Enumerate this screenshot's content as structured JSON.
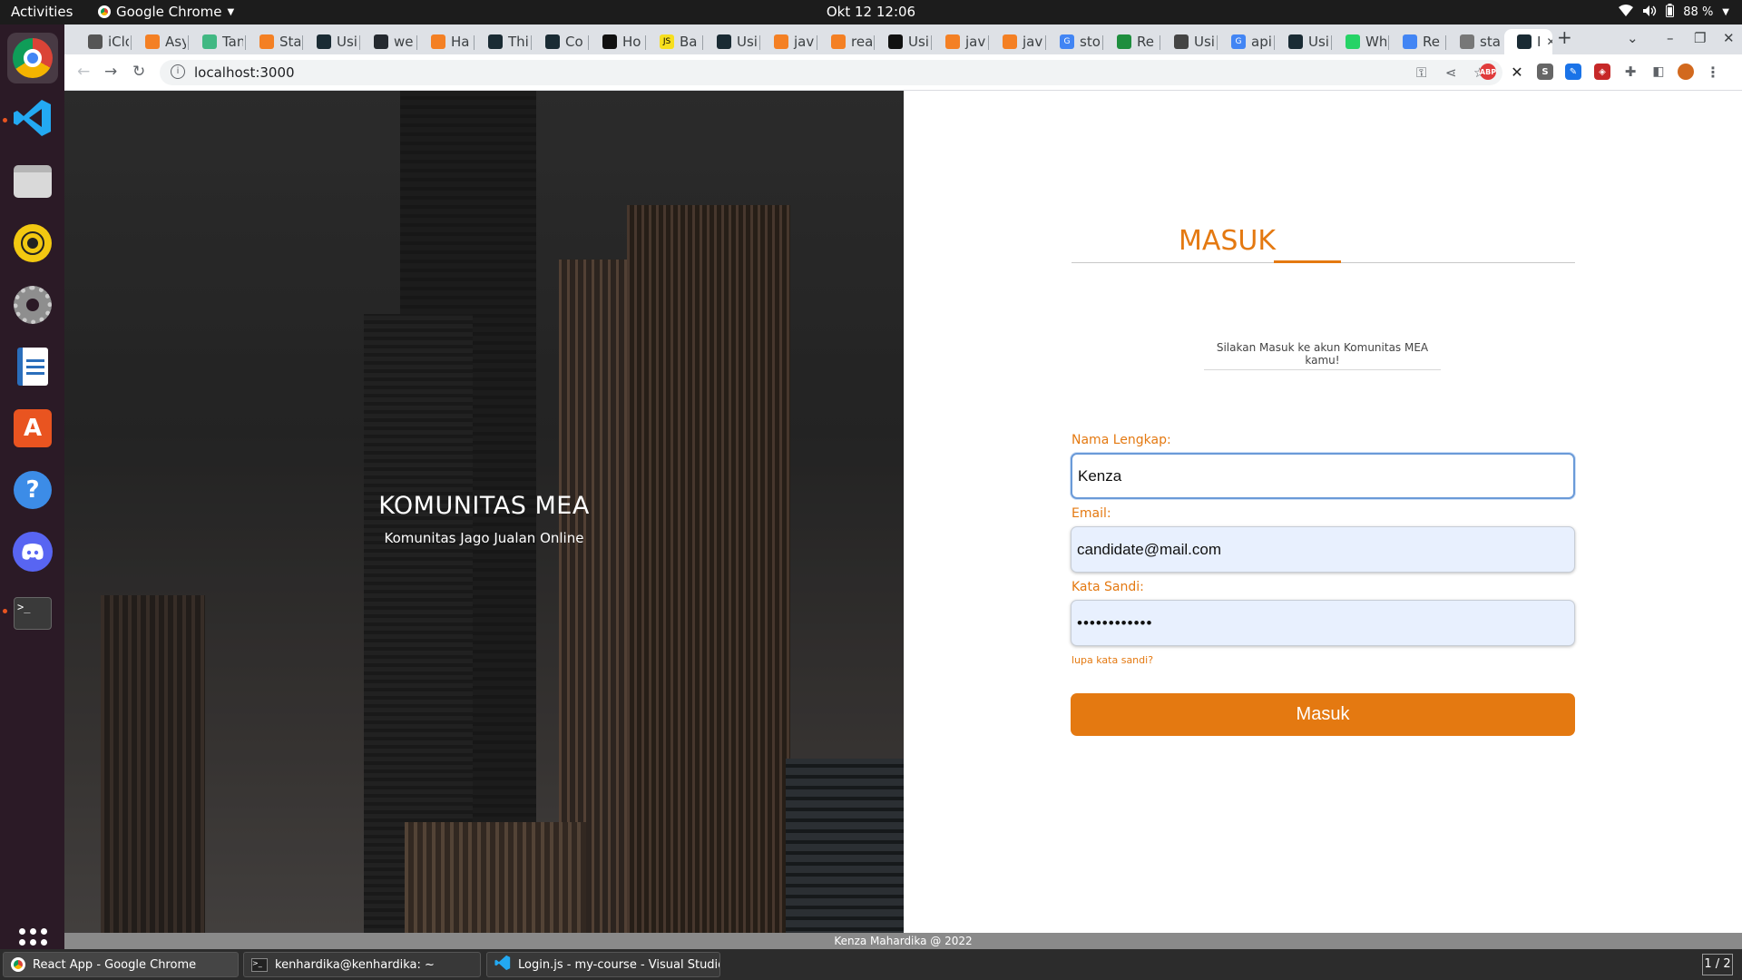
{
  "system": {
    "activities": "Activities",
    "app_menu": "Google Chrome",
    "clock": "Okt 12  12:06",
    "battery": "88 %"
  },
  "dock": {
    "items": [
      "chrome-icon",
      "vscode-icon",
      "files-icon",
      "rhythmbox-icon",
      "settings-icon",
      "writer-icon",
      "software-center-icon",
      "help-icon",
      "discord-icon",
      "terminal-icon"
    ]
  },
  "browser": {
    "tabs": [
      {
        "label": "iClo",
        "color": "#555555",
        "glyph": ""
      },
      {
        "label": "Asy",
        "color": "#f48024",
        "glyph": ""
      },
      {
        "label": "Tan",
        "color": "#41b883",
        "glyph": ""
      },
      {
        "label": "Sta",
        "color": "#f48024",
        "glyph": ""
      },
      {
        "label": "Usi",
        "color": "#1a2b34",
        "glyph": ""
      },
      {
        "label": "we",
        "color": "#24292f",
        "glyph": ""
      },
      {
        "label": "Ha",
        "color": "#f48024",
        "glyph": ""
      },
      {
        "label": "Thi",
        "color": "#1a2b34",
        "glyph": ""
      },
      {
        "label": "Co",
        "color": "#1a2b34",
        "glyph": ""
      },
      {
        "label": "Ho",
        "color": "#111111",
        "glyph": ""
      },
      {
        "label": "Ba",
        "color": "#f7df1e",
        "glyph": "JS"
      },
      {
        "label": "Usi",
        "color": "#1a2b34",
        "glyph": ""
      },
      {
        "label": "jav",
        "color": "#f48024",
        "glyph": ""
      },
      {
        "label": "rea",
        "color": "#f48024",
        "glyph": ""
      },
      {
        "label": "Usi",
        "color": "#111111",
        "glyph": ""
      },
      {
        "label": "jav",
        "color": "#f48024",
        "glyph": ""
      },
      {
        "label": "jav",
        "color": "#f48024",
        "glyph": ""
      },
      {
        "label": "sto",
        "color": "#4285f4",
        "glyph": "G"
      },
      {
        "label": "Re",
        "color": "#1e8e3e",
        "glyph": ""
      },
      {
        "label": "Usi",
        "color": "#444444",
        "glyph": ""
      },
      {
        "label": "api",
        "color": "#4285f4",
        "glyph": "G"
      },
      {
        "label": "Usi",
        "color": "#1a2b34",
        "glyph": ""
      },
      {
        "label": "Wh",
        "color": "#25d366",
        "glyph": ""
      },
      {
        "label": "Re",
        "color": "#4285f4",
        "glyph": ""
      },
      {
        "label": "sta",
        "color": "#777777",
        "glyph": ""
      },
      {
        "label": "I",
        "color": "#1a2b34",
        "glyph": ""
      }
    ],
    "url": "localhost:3000"
  },
  "hero": {
    "title": "KOMUNITAS MEA",
    "subtitle": "Komunitas Jago Jualan Online"
  },
  "login": {
    "title": "MASUK",
    "welcome": "Silakan Masuk ke akun Komunitas MEA kamu!",
    "name_label": "Nama Lengkap:",
    "name_value": "Kenza",
    "email_label": "Email:",
    "email_value": "candidate@mail.com",
    "password_label": "Kata Sandi:",
    "password_value": "••••••••••••",
    "forgot": "lupa kata sandi?",
    "submit": "Masuk"
  },
  "footer": "Kenza Mahardika @ 2022",
  "taskbar": {
    "items": [
      "React App - Google Chrome",
      "kenhardika@kenhardika: ~",
      "Login.js - my-course - Visual Studio..."
    ],
    "pager": "1 / 2"
  }
}
